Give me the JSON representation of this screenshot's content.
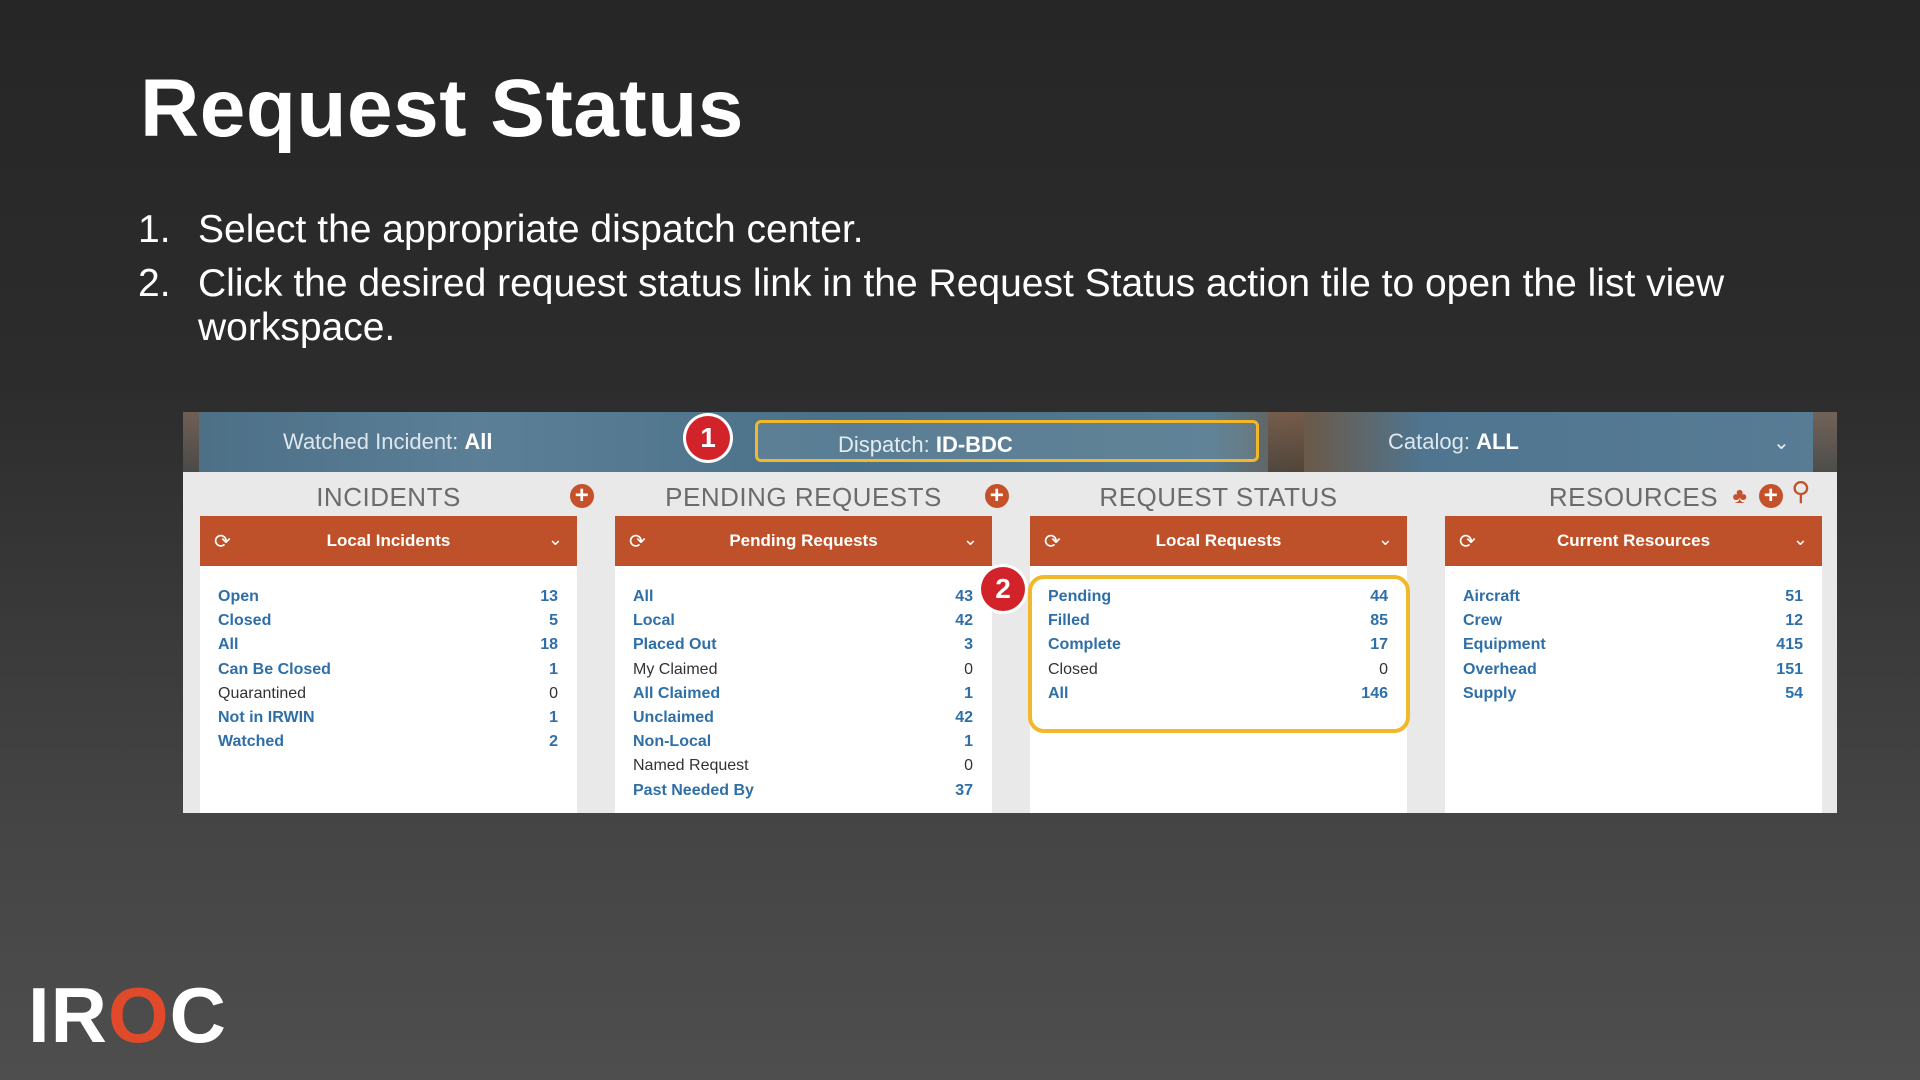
{
  "slide": {
    "title": "Request Status",
    "steps": [
      {
        "num": "1.",
        "text": "Select the appropriate dispatch center."
      },
      {
        "num": "2.",
        "text": "Click the desired request status link in the Request Status action tile to open the list view workspace."
      }
    ],
    "logo": {
      "prefix": "IR",
      "flame_letter": "O",
      "suffix": "C"
    }
  },
  "topbar": {
    "watched_prefix": "Watched Incident: ",
    "watched_value": "All",
    "dispatch_prefix": "Dispatch: ",
    "dispatch_value": "ID-BDC",
    "catalog_prefix": "Catalog: ",
    "catalog_value": "ALL"
  },
  "markers": {
    "one": "1",
    "two": "2"
  },
  "tiles": {
    "incidents": {
      "heading": "INCIDENTS",
      "bar_label": "Local Incidents",
      "rows": [
        {
          "label": "Open",
          "count": "13"
        },
        {
          "label": "Closed",
          "count": "5"
        },
        {
          "label": "All",
          "count": "18"
        },
        {
          "label": "Can Be Closed",
          "count": "1"
        },
        {
          "label": "Quarantined",
          "count": "0"
        },
        {
          "label": "Not in IRWIN",
          "count": "1"
        },
        {
          "label": "Watched",
          "count": "2"
        }
      ]
    },
    "pending": {
      "heading": "PENDING REQUESTS",
      "bar_label": "Pending Requests",
      "rows": [
        {
          "label": "All",
          "count": "43"
        },
        {
          "label": "Local",
          "count": "42"
        },
        {
          "label": "Placed Out",
          "count": "3"
        },
        {
          "label": "My Claimed",
          "count": "0"
        },
        {
          "label": "All Claimed",
          "count": "1"
        },
        {
          "label": "Unclaimed",
          "count": "42"
        },
        {
          "label": "Non-Local",
          "count": "1"
        },
        {
          "label": "Named Request",
          "count": "0"
        },
        {
          "label": "Past Needed By",
          "count": "37"
        }
      ]
    },
    "status": {
      "heading": "REQUEST STATUS",
      "bar_label": "Local Requests",
      "rows": [
        {
          "label": "Pending",
          "count": "44"
        },
        {
          "label": "Filled",
          "count": "85"
        },
        {
          "label": "Complete",
          "count": "17"
        },
        {
          "label": "Closed",
          "count": "0"
        },
        {
          "label": "All",
          "count": "146"
        }
      ]
    },
    "resources": {
      "heading": "RESOURCES",
      "bar_label": "Current Resources",
      "rows": [
        {
          "label": "Aircraft",
          "count": "51"
        },
        {
          "label": "Crew",
          "count": "12"
        },
        {
          "label": "Equipment",
          "count": "415"
        },
        {
          "label": "Overhead",
          "count": "151"
        },
        {
          "label": "Supply",
          "count": "54"
        }
      ]
    }
  },
  "icons": {
    "refresh": "refresh-icon",
    "chevron": "chevron-down-icon",
    "add": "add-icon",
    "hierarchy": "hierarchy-icon",
    "search": "search-icon"
  }
}
